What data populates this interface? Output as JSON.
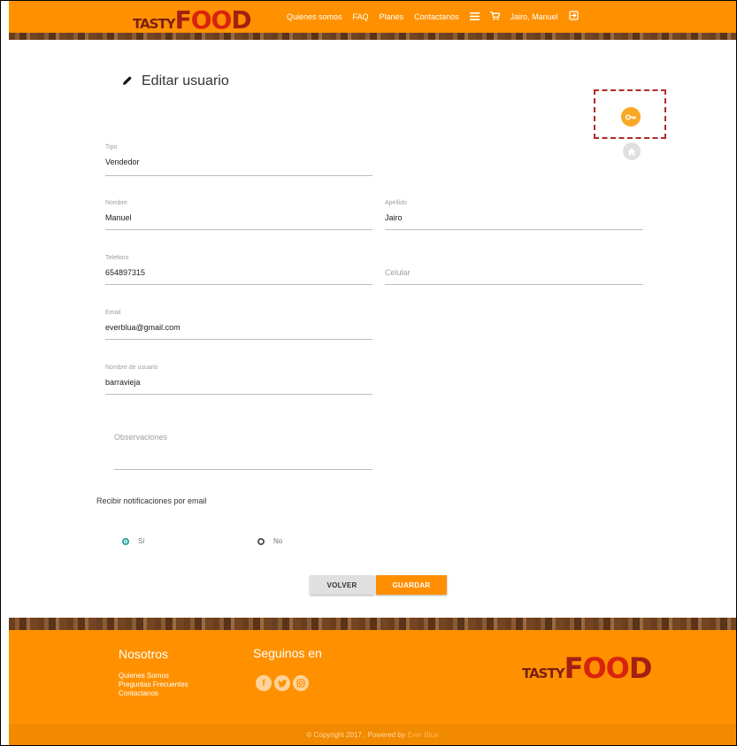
{
  "header": {
    "logo": {
      "part1": "TASTY",
      "part2": "F",
      "part3": "OO",
      "part4": "D"
    },
    "nav": [
      "Quienes somos",
      "FAQ",
      "Planes",
      "Contactanos"
    ],
    "user": "Jairo, Manuel",
    "icons": [
      "menu-icon",
      "cart-icon",
      "logout-icon"
    ]
  },
  "page": {
    "title": "Editar usuario"
  },
  "form": {
    "tipo": {
      "label": "Tipo",
      "value": "Vendedor"
    },
    "nombre": {
      "label": "Nombre",
      "value": "Manuel"
    },
    "apellido": {
      "label": "Apellido",
      "value": "Jairo"
    },
    "telefono": {
      "label": "Telefono",
      "value": "654897315"
    },
    "celular": {
      "placeholder": "Celular"
    },
    "email": {
      "label": "Email",
      "value": "everblua@gmail.com"
    },
    "usuario": {
      "label": "Nombre de usuario",
      "value": "barravieja"
    },
    "observaciones": {
      "placeholder": "Observaciones"
    },
    "notif_label": "Recibir notificaciones por email",
    "radio_si": "Sí",
    "radio_no": "No",
    "radio_selected": "Sí"
  },
  "buttons": {
    "volver": "VOLVER",
    "guardar": "GUARDAR"
  },
  "colors": {
    "accent": "#ff9100",
    "fab_key": "#f9a825",
    "radio_on": "#26a69a"
  },
  "footer": {
    "nosotros_title": "Nosotros",
    "links": [
      "Quienes Somos",
      "Preguntas Frecuentes",
      "Contactanos"
    ],
    "seguinos_title": "Seguinos en",
    "social": [
      "f",
      "t",
      "o"
    ],
    "copyright": "© Copyright 2017 . Powered by ",
    "powered": "Ever Blua"
  }
}
